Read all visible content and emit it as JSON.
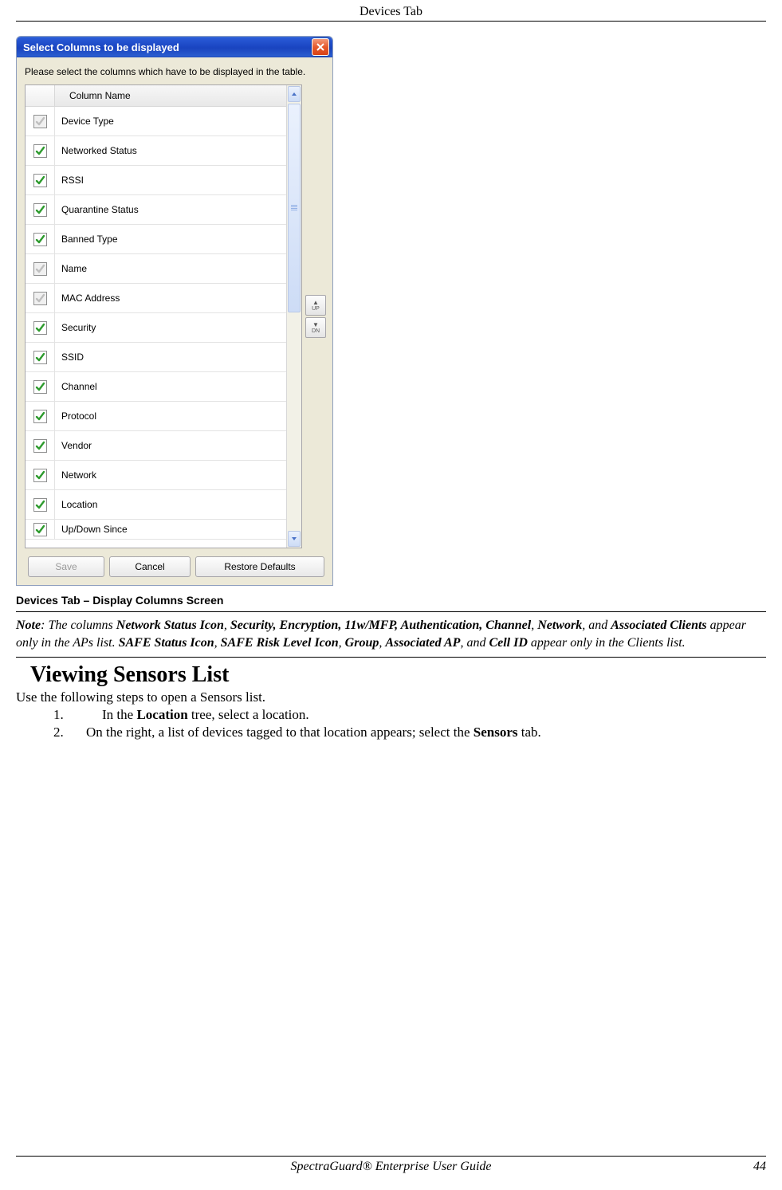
{
  "header": {
    "title": "Devices Tab"
  },
  "footer": {
    "guide": "SpectraGuard®  Enterprise User Guide",
    "page": "44"
  },
  "dialog": {
    "title": "Select Columns to be displayed",
    "instruction": "Please select the columns which have to be displayed in the table.",
    "header_label": "Column Name",
    "rows": [
      {
        "label": "Device Type",
        "checked": true,
        "enabled": false
      },
      {
        "label": "Networked Status",
        "checked": true,
        "enabled": true
      },
      {
        "label": "RSSI",
        "checked": true,
        "enabled": true
      },
      {
        "label": "Quarantine Status",
        "checked": true,
        "enabled": true
      },
      {
        "label": "Banned Type",
        "checked": true,
        "enabled": true
      },
      {
        "label": "Name",
        "checked": true,
        "enabled": false
      },
      {
        "label": "MAC Address",
        "checked": true,
        "enabled": false
      },
      {
        "label": "Security",
        "checked": true,
        "enabled": true
      },
      {
        "label": "SSID",
        "checked": true,
        "enabled": true
      },
      {
        "label": "Channel",
        "checked": true,
        "enabled": true
      },
      {
        "label": "Protocol",
        "checked": true,
        "enabled": true
      },
      {
        "label": "Vendor",
        "checked": true,
        "enabled": true
      },
      {
        "label": "Network",
        "checked": true,
        "enabled": true
      },
      {
        "label": "Location",
        "checked": true,
        "enabled": true
      },
      {
        "label": "Up/Down Since",
        "checked": true,
        "enabled": true
      }
    ],
    "reorder": {
      "up": "UP",
      "down": "DN"
    },
    "buttons": {
      "save": "Save",
      "cancel": "Cancel",
      "restore": "Restore Defaults"
    }
  },
  "caption": "Devices Tab – Display Columns Screen",
  "note": {
    "lead": "Note",
    "t1": ": The columns ",
    "b1": "Network Status Icon",
    "t2": ", ",
    "b2": "Security, Encryption, 11w/MFP, Authentication, Channel",
    "t3": ", ",
    "b3": "Network",
    "t4": ", and ",
    "b4": "Associated Clients",
    "t5": " appear only in the APs list. ",
    "b5": "SAFE Status Icon",
    "t6": ", ",
    "b6": "SAFE Risk Level Icon",
    "t7": ", ",
    "b7": "Group",
    "t8": ", ",
    "b8": "Associated AP",
    "t9": ", and ",
    "b9": "Cell ID",
    "t10": " appear only in the Clients list."
  },
  "section": {
    "heading": "Viewing Sensors List",
    "intro": "Use the following steps to open a Sensors list.",
    "step1_a": "In the ",
    "step1_b": "Location",
    "step1_c": " tree, select a location.",
    "step2_a": "On the right, a list of devices tagged to that location appears; select the ",
    "step2_b": "Sensors",
    "step2_c": " tab."
  }
}
